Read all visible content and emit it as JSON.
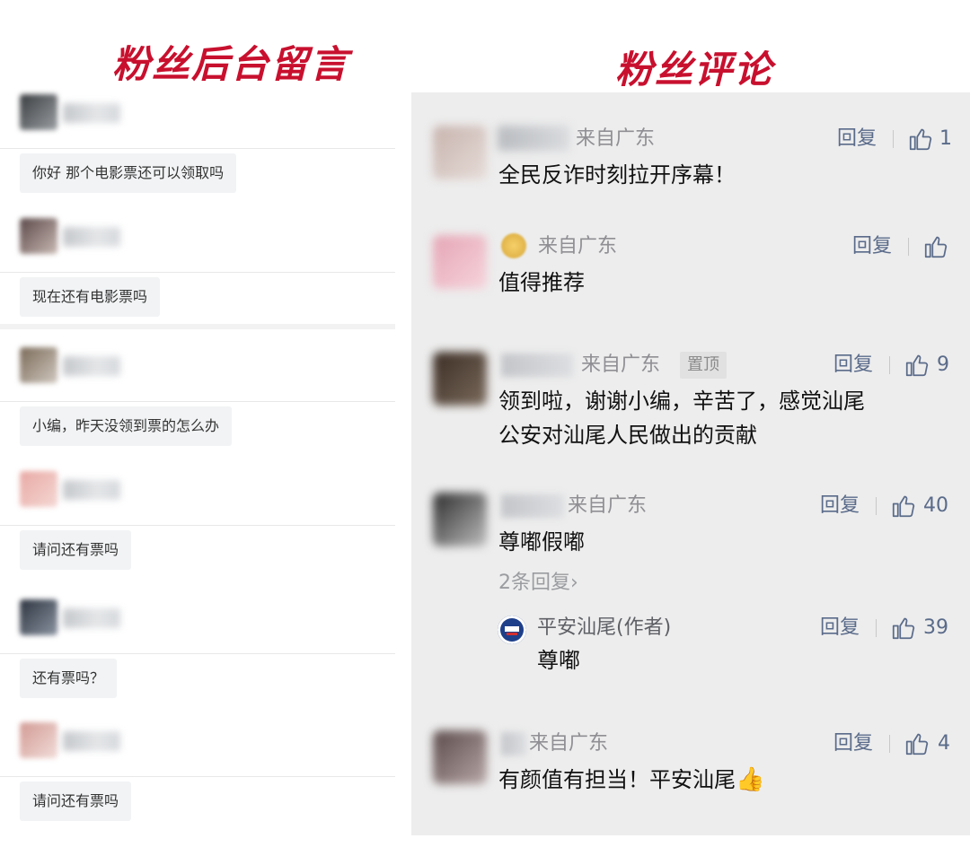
{
  "headings": {
    "left": "粉丝后台留言",
    "right": "粉丝评论"
  },
  "left_messages": [
    {
      "text": "你好 那个电影票还可以领取吗"
    },
    {
      "text": "现在还有电影票吗"
    },
    {
      "text": "小编，昨天没领到票的怎么办"
    },
    {
      "text": "请问还有票吗"
    },
    {
      "text": "还有票吗？"
    },
    {
      "text": "请问还有票吗"
    }
  ],
  "comments": [
    {
      "from": "来自广东",
      "text": "全民反诈时刻拉开序幕！",
      "reply": "回复",
      "likes": "1"
    },
    {
      "from": "来自广东",
      "text": "值得推荐",
      "reply": "回复",
      "likes": ""
    },
    {
      "name_suffix": "凌𝓛.",
      "from": "来自广东",
      "pin": "置顶",
      "text_line1": "领到啦，谢谢小编，辛苦了，感觉汕尾",
      "text_line2": "公安对汕尾人民做出的贡献",
      "reply": "回复",
      "likes": "9"
    },
    {
      "name_suffix": "ant",
      "from": "来自广东",
      "text": "尊嘟假嘟",
      "reply": "回复",
      "likes": "40",
      "more_replies": "2条回复",
      "author_reply": {
        "name": "平安汕尾(作者)",
        "text": "尊嘟",
        "reply": "回复",
        "likes": "39"
      }
    },
    {
      "from": "来自广东",
      "text": "有颜值有担当！平安汕尾",
      "emoji": "👍",
      "reply": "回复",
      "likes": "4"
    }
  ],
  "colors": {
    "heading": "#c8102e",
    "right_panel_bg": "#ededed",
    "link": "#5a6b8a"
  },
  "icons": {
    "like": "thumbs-up-icon",
    "more": "chevron-right-icon"
  }
}
